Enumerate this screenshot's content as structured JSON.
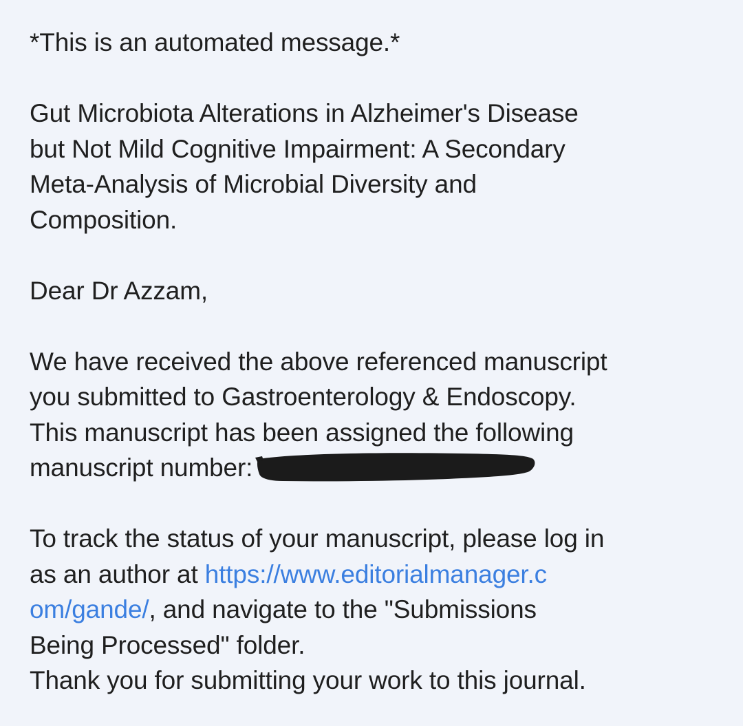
{
  "email": {
    "automated_notice": "*This is an automated message.*",
    "title_lines": [
      "Gut Microbiota Alterations in Alzheimer's Disease",
      "but Not Mild Cognitive Impairment: A Secondary",
      "Meta-Analysis of Microbial Diversity and",
      "Composition."
    ],
    "greeting": "Dear Dr Azzam,",
    "received_lines": [
      "We have received the above referenced manuscript",
      "you submitted to Gastroenterology & Endoscopy.",
      "This manuscript has been assigned the following"
    ],
    "manuscript_number_label": "manuscript number:",
    "track_line_1": "To track the status of your manuscript, please log in",
    "track_line_2_prefix": "as an author at ",
    "link_part_1": "https://www.editorialmanager.c",
    "link_part_2": "om/gande/",
    "track_line_3_suffix": ", and navigate to the \"Submissions",
    "track_line_4": "Being Processed\" folder.",
    "thanks": "Thank you for submitting your work to this journal."
  },
  "colors": {
    "background": "#f1f4fa",
    "text": "#1f1f1f",
    "link": "#3b7fe0",
    "redaction": "#1b1b1b"
  }
}
